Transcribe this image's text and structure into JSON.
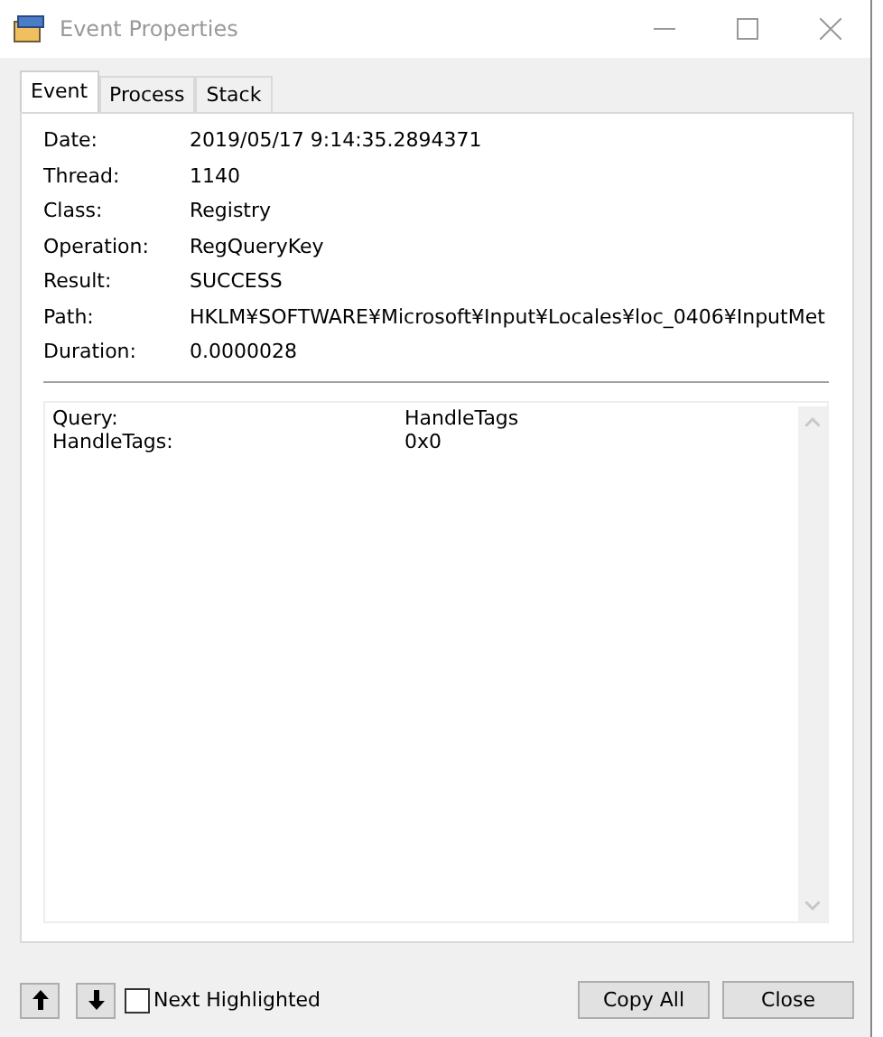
{
  "window": {
    "title": "Event Properties"
  },
  "tabs": [
    {
      "label": "Event",
      "selected": true
    },
    {
      "label": "Process",
      "selected": false
    },
    {
      "label": "Stack",
      "selected": false
    }
  ],
  "fields": [
    {
      "label": "Date:",
      "value": "2019/05/17 9:14:35.2894371"
    },
    {
      "label": "Thread:",
      "value": "1140"
    },
    {
      "label": "Class:",
      "value": "Registry"
    },
    {
      "label": "Operation:",
      "value": "RegQueryKey"
    },
    {
      "label": "Result:",
      "value": "SUCCESS"
    },
    {
      "label": "Path:",
      "value": "HKLM¥SOFTWARE¥Microsoft¥Input¥Locales¥loc_0406¥InputMet"
    },
    {
      "label": "Duration:",
      "value": "0.0000028"
    }
  ],
  "details": [
    {
      "name": "Query:",
      "value": "HandleTags"
    },
    {
      "name": "HandleTags:",
      "value": "0x0"
    }
  ],
  "next_highlighted": {
    "label": "Next Highlighted",
    "checked": false
  },
  "buttons": [
    "Copy All",
    "Close"
  ]
}
